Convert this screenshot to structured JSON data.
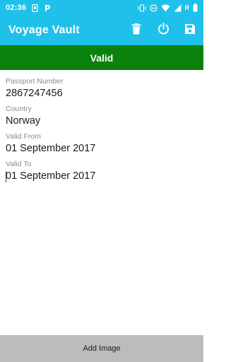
{
  "status_bar": {
    "time": "02:36",
    "carrier_indicator": "R",
    "icons": [
      "sim-card-icon",
      "parking-icon",
      "vibrate-icon",
      "do-not-disturb-icon",
      "wifi-icon",
      "cellular-signal-icon",
      "battery-icon"
    ]
  },
  "app_bar": {
    "title": "Voyage Vault",
    "actions": [
      "delete-icon",
      "power-icon",
      "save-icon"
    ]
  },
  "banner": {
    "text": "Valid",
    "color": "#0b820b"
  },
  "fields": [
    {
      "label": "Passport Number",
      "value": "2867247456"
    },
    {
      "label": "Country",
      "value": "Norway"
    },
    {
      "label": "Valid From",
      "value": "01 September 2017"
    },
    {
      "label": "Valid To",
      "value": "01 September 2017"
    }
  ],
  "bottom_button": {
    "label": "Add Image"
  },
  "colors": {
    "primary": "#1fc1ea",
    "valid": "#0b820b",
    "button": "#bcbcbc"
  }
}
